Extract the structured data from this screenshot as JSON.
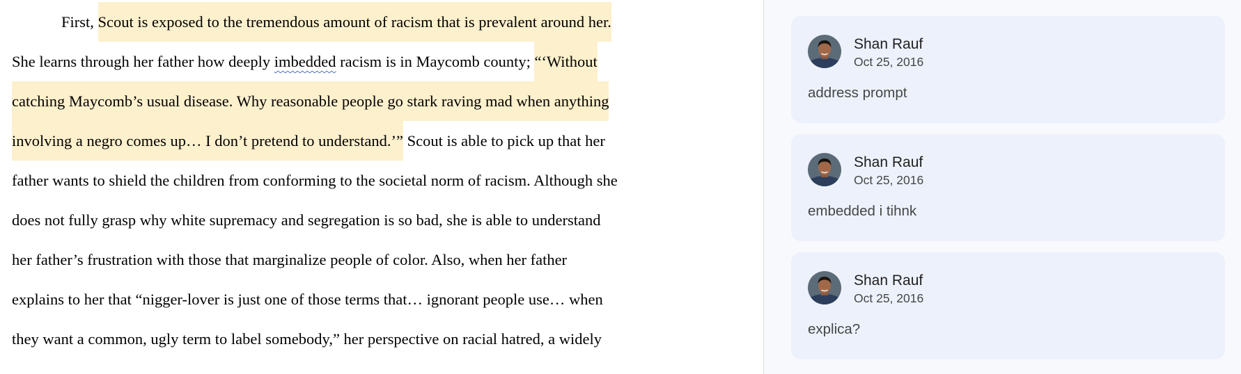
{
  "document": {
    "lines": [
      {
        "a": "First, ",
        "b": "Scout is exposed to the tremendous amount of racism that is prevalent around her."
      },
      {
        "a": "She learns through her father how deeply ",
        "b": "imbedded",
        "c": " racism is in Maycomb county; ",
        "d": "“‘Without"
      },
      {
        "a": "catching Maycomb’s usual disease. Why reasonable people go stark raving mad when anything"
      },
      {
        "a": "involving a negro comes up… I don’t pretend to understand.’”",
        "b": " Scout is able to pick up that her"
      },
      {
        "a": "father wants to shield the children from conforming to the societal norm of racism. Although she"
      },
      {
        "a": "does not fully grasp why white supremacy and segregation is so bad, she is able to understand"
      },
      {
        "a": "her father’s frustration with those that marginalize people of color. Also, when her father"
      },
      {
        "a": "explains to her that “nigger-lover is just one of those terms that… ignorant people use… when"
      },
      {
        "a": "they want a common, ugly term to label somebody,” her perspective on racial hatred, a widely"
      }
    ]
  },
  "comments": [
    {
      "author": "Shan Rauf",
      "date": "Oct 25, 2016",
      "text": "address prompt"
    },
    {
      "author": "Shan Rauf",
      "date": "Oct 25, 2016",
      "text": "embedded i tihnk"
    },
    {
      "author": "Shan Rauf",
      "date": "Oct 25, 2016",
      "text": "explica?"
    }
  ],
  "colors": {
    "highlight": "#fdf0cc",
    "comment_card": "#edf1fb",
    "sidebar_bg": "#f8f9fd"
  }
}
